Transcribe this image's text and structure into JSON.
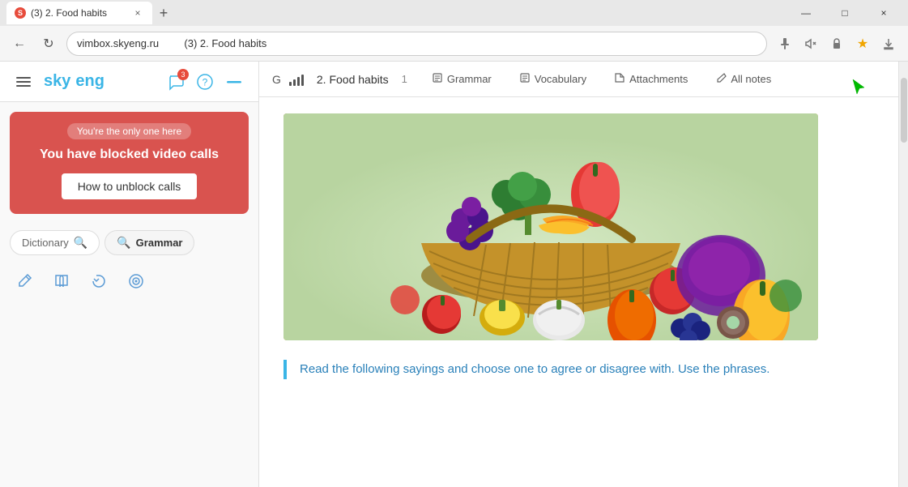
{
  "browser": {
    "tab": {
      "favicon": "S",
      "title": "(3) 2. Food habits",
      "close_label": "×"
    },
    "new_tab_label": "+",
    "window_controls": {
      "minimize": "—",
      "maximize": "□",
      "close": "×"
    },
    "address_bar": {
      "back": "←",
      "refresh": "↻",
      "url": "vimbox.skyeng.ru",
      "page_title": "(3) 2. Food habits"
    },
    "toolbar": {
      "pin": "📌",
      "mute": "🔇",
      "lock": "🔒",
      "star": "★",
      "download": "⬇"
    }
  },
  "sidebar": {
    "logo": {
      "prefix": "sky",
      "suffix": "eng"
    },
    "icons": {
      "chat_badge": "3",
      "chat_icon": "💬",
      "help_icon": "?",
      "minus_icon": "—"
    },
    "blocked_card": {
      "only_one_text": "You're the only one here",
      "blocked_title": "You have blocked video calls",
      "unblock_label": "How to unblock calls"
    },
    "search_tabs": {
      "dictionary_label": "Dictionary",
      "grammar_label": "Grammar",
      "search_placeholder": "Search"
    },
    "tools": {
      "pen_icon": "✏",
      "book_icon": "📖",
      "refresh_icon": "↻",
      "target_icon": "🎯"
    }
  },
  "lesson": {
    "nav": {
      "g_label": "G",
      "lesson_title": "2. Food habits",
      "lesson_num": "1",
      "tabs": [
        {
          "icon": "📄",
          "label": "Grammar"
        },
        {
          "icon": "📄",
          "label": "Vocabulary"
        },
        {
          "icon": "📎",
          "label": "Attachments"
        },
        {
          "icon": "📝",
          "label": "All notes"
        }
      ]
    },
    "content": {
      "quote_text": "Read the following sayings and choose one to agree or disagree with. Use the phrases."
    }
  },
  "colors": {
    "accent_blue": "#3ab5e6",
    "red_card": "#d9534f",
    "quote_blue": "#2980b9",
    "quote_border": "#3ab5e6"
  }
}
